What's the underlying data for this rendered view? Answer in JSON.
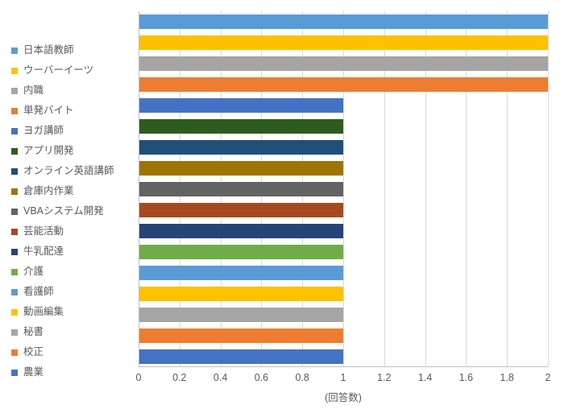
{
  "chart_data": {
    "type": "bar",
    "orientation": "horizontal",
    "xlabel": "(回答数)",
    "xlim": [
      0,
      2
    ],
    "xticks": [
      0,
      0.2,
      0.4,
      0.6,
      0.8,
      1,
      1.2,
      1.4,
      1.6,
      1.8,
      2
    ],
    "series": [
      {
        "name": "日本語教師",
        "value": 2,
        "color": "#5b9bd5"
      },
      {
        "name": "ウーバーイーツ",
        "value": 2,
        "color": "#ffc000"
      },
      {
        "name": "内職",
        "value": 2,
        "color": "#a5a5a5"
      },
      {
        "name": "単発バイト",
        "value": 2,
        "color": "#ed7d31"
      },
      {
        "name": "ヨガ講師",
        "value": 1,
        "color": "#4472c4"
      },
      {
        "name": "アプリ開発",
        "value": 1,
        "color": "#2e5c1f"
      },
      {
        "name": "オンライン英語講師",
        "value": 1,
        "color": "#1f4e79"
      },
      {
        "name": "倉庫内作業",
        "value": 1,
        "color": "#9e7500"
      },
      {
        "name": "VBAシステム開発",
        "value": 1,
        "color": "#636363"
      },
      {
        "name": "芸能活動",
        "value": 1,
        "color": "#a64a1e"
      },
      {
        "name": "牛乳配達",
        "value": 1,
        "color": "#264478"
      },
      {
        "name": "介護",
        "value": 1,
        "color": "#70ad47"
      },
      {
        "name": "看護師",
        "value": 1,
        "color": "#5b9bd5"
      },
      {
        "name": "動画編集",
        "value": 1,
        "color": "#ffc000"
      },
      {
        "name": "秘書",
        "value": 1,
        "color": "#a5a5a5"
      },
      {
        "name": "校正",
        "value": 1,
        "color": "#ed7d31"
      },
      {
        "name": "農業",
        "value": 1,
        "color": "#4472c4"
      }
    ]
  }
}
